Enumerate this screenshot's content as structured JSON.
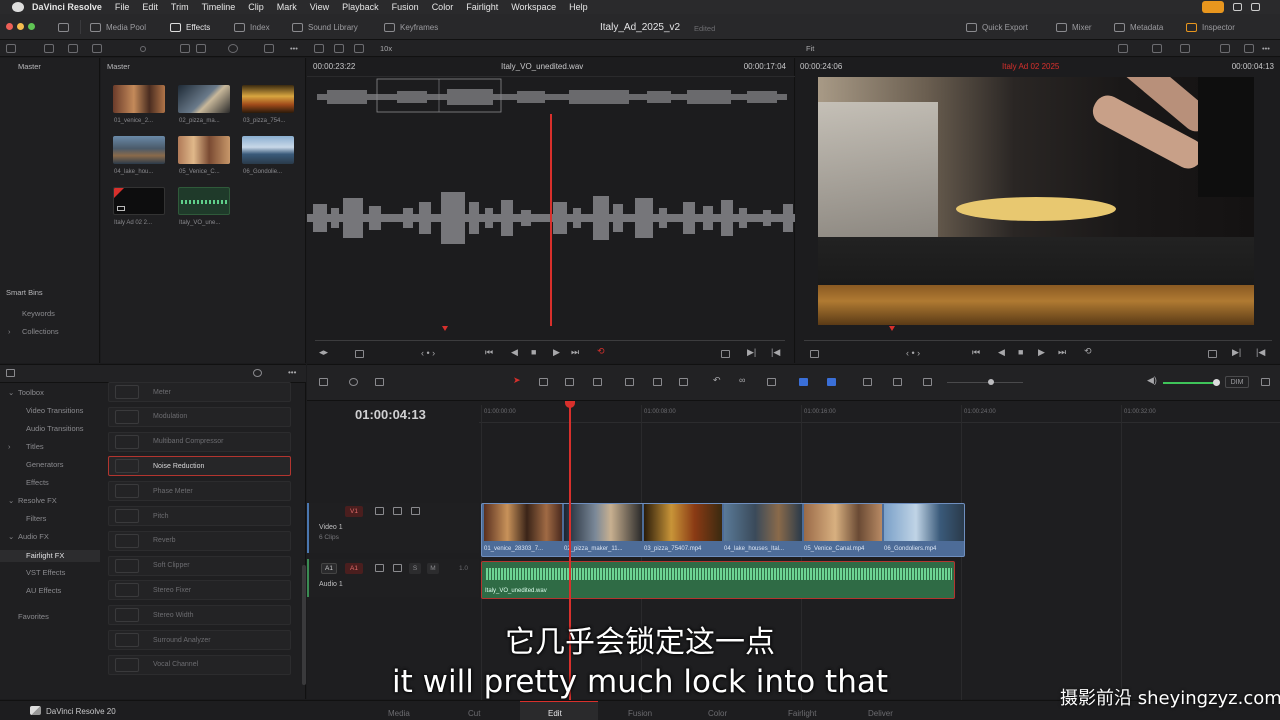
{
  "menubar": {
    "items": [
      "DaVinci Resolve",
      "File",
      "Edit",
      "Trim",
      "Timeline",
      "Clip",
      "Mark",
      "View",
      "Playback",
      "Fusion",
      "Color",
      "Fairlight",
      "Workspace",
      "Help"
    ]
  },
  "toolbar": {
    "media_pool": "Media Pool",
    "effects": "Effects",
    "index": "Index",
    "sound_library": "Sound Library",
    "keyframes": "Keyframes",
    "project_title": "Italy_Ad_2025_v2",
    "project_status": "Edited",
    "quick_export": "Quick Export",
    "mixer": "Mixer",
    "metadata": "Metadata",
    "inspector": "Inspector"
  },
  "subbar": {
    "zoom": "10x",
    "fit": "Fit"
  },
  "media_pool": {
    "bin_header": "Master",
    "pool_header": "Master",
    "smart_bins": "Smart Bins",
    "keywords": "Keywords",
    "collections": "Collections",
    "clips": [
      "01_venice_2...",
      "02_pizza_ma...",
      "03_pizza_754...",
      "04_lake_hou...",
      "05_Venice_C...",
      "06_Gondolie...",
      "Italy Ad 02 2...",
      "Italy_VO_une..."
    ]
  },
  "source_viewer": {
    "tc_left": "00:00:23:22",
    "clip_name": "Italy_VO_unedited.wav",
    "tc_right": "00:00:17:04"
  },
  "timeline_viewer": {
    "tc_left": "00:00:24:06",
    "timeline_name": "Italy Ad 02 2025",
    "tc_right": "00:00:04:13"
  },
  "effects": {
    "categories": [
      {
        "label": "Toolbox",
        "indent": 0
      },
      {
        "label": "Video Transitions",
        "indent": 1
      },
      {
        "label": "Audio Transitions",
        "indent": 1
      },
      {
        "label": "Titles",
        "indent": 1
      },
      {
        "label": "Generators",
        "indent": 1
      },
      {
        "label": "Effects",
        "indent": 1
      },
      {
        "label": "Resolve FX",
        "indent": 0
      },
      {
        "label": "Filters",
        "indent": 1
      },
      {
        "label": "Audio FX",
        "indent": 0
      },
      {
        "label": "Fairlight FX",
        "indent": 1
      },
      {
        "label": "VST Effects",
        "indent": 1
      },
      {
        "label": "AU Effects",
        "indent": 1
      },
      {
        "label": "Favorites",
        "indent": 0
      }
    ],
    "items": [
      "Meter",
      "Modulation",
      "Multiband Compressor",
      "Noise Reduction",
      "Phase Meter",
      "Pitch",
      "Reverb",
      "Soft Clipper",
      "Stereo Fixer",
      "Stereo Width",
      "Surround Analyzer",
      "Vocal Channel"
    ],
    "selected": "Noise Reduction"
  },
  "timeline": {
    "current_tc": "01:00:04:13",
    "dim": "DIM",
    "ruler": [
      "01:00:00:00",
      "01:00:08:00",
      "01:00:16:00",
      "01:00:24:00",
      "01:00:32:00"
    ],
    "video_track": {
      "id": "V1",
      "name": "Video 1",
      "clips_count": "6 Clips"
    },
    "audio_track": {
      "id": "A1",
      "name": "Audio 1",
      "level": "1.0",
      "solo": "S",
      "mute": "M"
    },
    "video_clips": [
      "01_venice_28303_7...",
      "02_pizza_maker_11...",
      "03_pizza_75407.mp4",
      "04_lake_houses_Ital...",
      "05_Venice_Canal.mp4",
      "06_Gondoliers.mp4"
    ],
    "audio_clip": "Italy_VO_unedited.wav"
  },
  "subtitles": {
    "zh": "它几乎会锁定这一点",
    "en": "it will pretty much lock into that"
  },
  "watermark": "摄影前沿 sheyingzyz.com",
  "pagebar": {
    "brand": "DaVinci Resolve 20",
    "tabs": [
      "Media",
      "Cut",
      "Edit",
      "Fusion",
      "Color",
      "Fairlight",
      "Deliver"
    ],
    "active": "Edit"
  },
  "colors": {
    "playhead": "#d8302c",
    "video_clip": "#5577a8",
    "audio_clip": "#2f6b45",
    "selection": "#b3352f",
    "record": "#e8961e"
  }
}
